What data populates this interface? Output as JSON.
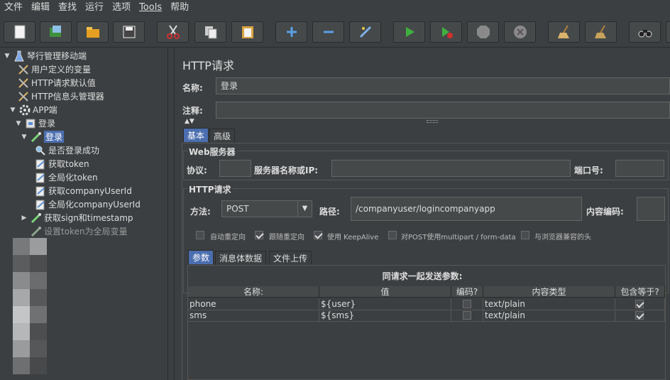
{
  "menu": [
    "文件",
    "编辑",
    "查找",
    "运行",
    "选项",
    "Tools",
    "帮助"
  ],
  "toolbar_icons": [
    "new-icon",
    "templates-icon",
    "open-icon",
    "save-icon",
    "cut-icon",
    "copy-icon",
    "paste-icon",
    "expand-icon",
    "collapse-icon",
    "toggle-icon",
    "start-icon",
    "start-no-pause-icon",
    "stop-icon",
    "shutdown-icon",
    "clear-icon",
    "clear-all-icon",
    "search-icon"
  ],
  "tree": {
    "root": "琴行管理移动端",
    "user_vars": "用户定义的变量",
    "http_defaults": "HTTP请求默认值",
    "header_manager": "HTTP信息头管理器",
    "app": "APP端",
    "login_controller": "登录",
    "login_sampler": "登录",
    "assert_login": "是否登录成功",
    "get_token": "获取token",
    "global_token": "全局化token",
    "get_company_user": "获取companyUserId",
    "global_company_user": "全局化companyUserId",
    "get_sign": "获取sign和timestamp",
    "set_token": "设置token为全局变量"
  },
  "panel": {
    "title": "HTTP请求",
    "name_label": "名称:",
    "name_value": "登录",
    "comment_label": "注释:",
    "comment_value": "",
    "tabs": [
      "基本",
      "高级"
    ],
    "web_server": {
      "title": "Web服务器",
      "protocol_label": "协议:",
      "protocol_value": "",
      "server_label": "服务器名称或IP:",
      "server_value": "",
      "port_label": "端口号:",
      "port_value": ""
    },
    "http_request": {
      "title": "HTTP请求",
      "method_label": "方法:",
      "method_value": "POST",
      "path_label": "路径:",
      "path_value": "/companyuser/logincompanyapp",
      "encoding_label": "内容编码:",
      "encoding_value": ""
    },
    "options": [
      {
        "label": "自动重定向",
        "checked": false
      },
      {
        "label": "跟随重定向",
        "checked": true
      },
      {
        "label": "使用 KeepAlive",
        "checked": true
      },
      {
        "label": "对POST使用multipart / form-data",
        "checked": false
      },
      {
        "label": "与浏览器兼容的头",
        "checked": false
      }
    ],
    "param_tabs": [
      "参数",
      "消息体数据",
      "文件上传"
    ],
    "params_caption": "同请求一起发送参数:",
    "columns": [
      "名称:",
      "值",
      "编码?",
      "内容类型",
      "包含等于?"
    ],
    "rows": [
      {
        "name": "phone",
        "value": "${user}",
        "encode": false,
        "type": "text/plain",
        "include_equals": true
      },
      {
        "name": "sms",
        "value": "${sms}",
        "encode": false,
        "type": "text/plain",
        "include_equals": true
      }
    ]
  }
}
